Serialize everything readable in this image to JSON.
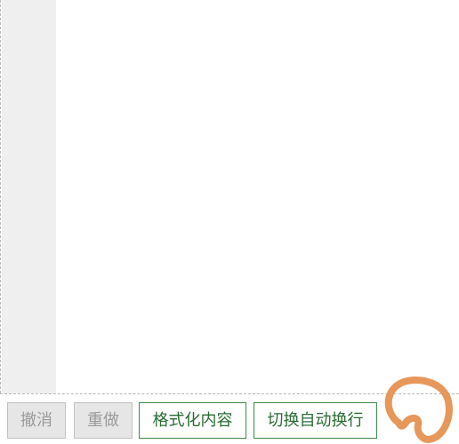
{
  "editor": {
    "content": ""
  },
  "toolbar": {
    "undo_label": "撤消",
    "redo_label": "重做",
    "format_label": "格式化内容",
    "wrap_label": "切换自动换行"
  },
  "colors": {
    "accent": "#3e8a46",
    "accent_text": "#2a6b33",
    "disabled_bg": "#e6e6e6",
    "gutter_bg": "#efefef",
    "annotation": "#e8975a"
  }
}
